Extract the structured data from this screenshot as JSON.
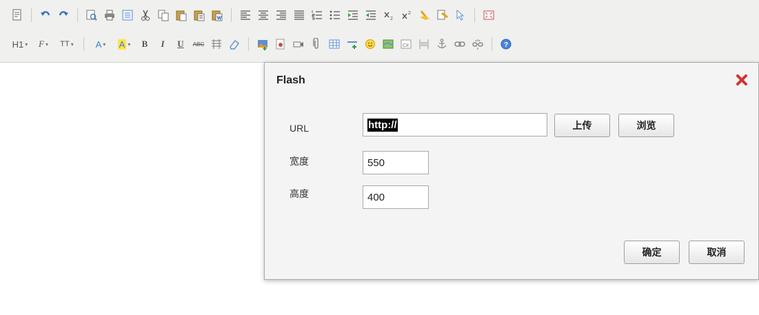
{
  "dialog": {
    "title": "Flash",
    "url_label": "URL",
    "url_value": "http://",
    "upload_label": "上传",
    "browse_label": "浏览",
    "width_label": "宽度",
    "width_value": "550",
    "height_label": "高度",
    "height_value": "400",
    "ok_label": "确定",
    "cancel_label": "取消"
  },
  "toolbar": {
    "heading_label": "H1",
    "font_label": "F",
    "size_label": "TT",
    "forecolor_label": "A",
    "hilitecolor_label": "A",
    "bold_label": "B",
    "italic_label": "I",
    "underline_label": "U",
    "strike_label": "ABC"
  },
  "colors": {
    "toolbar_bg": "#f0f0ee",
    "dialog_bg": "#f4f4f4",
    "close_icon": "#d23232",
    "hilite_bg": "#ffe44d",
    "forecolor": "#3d7bd8"
  }
}
